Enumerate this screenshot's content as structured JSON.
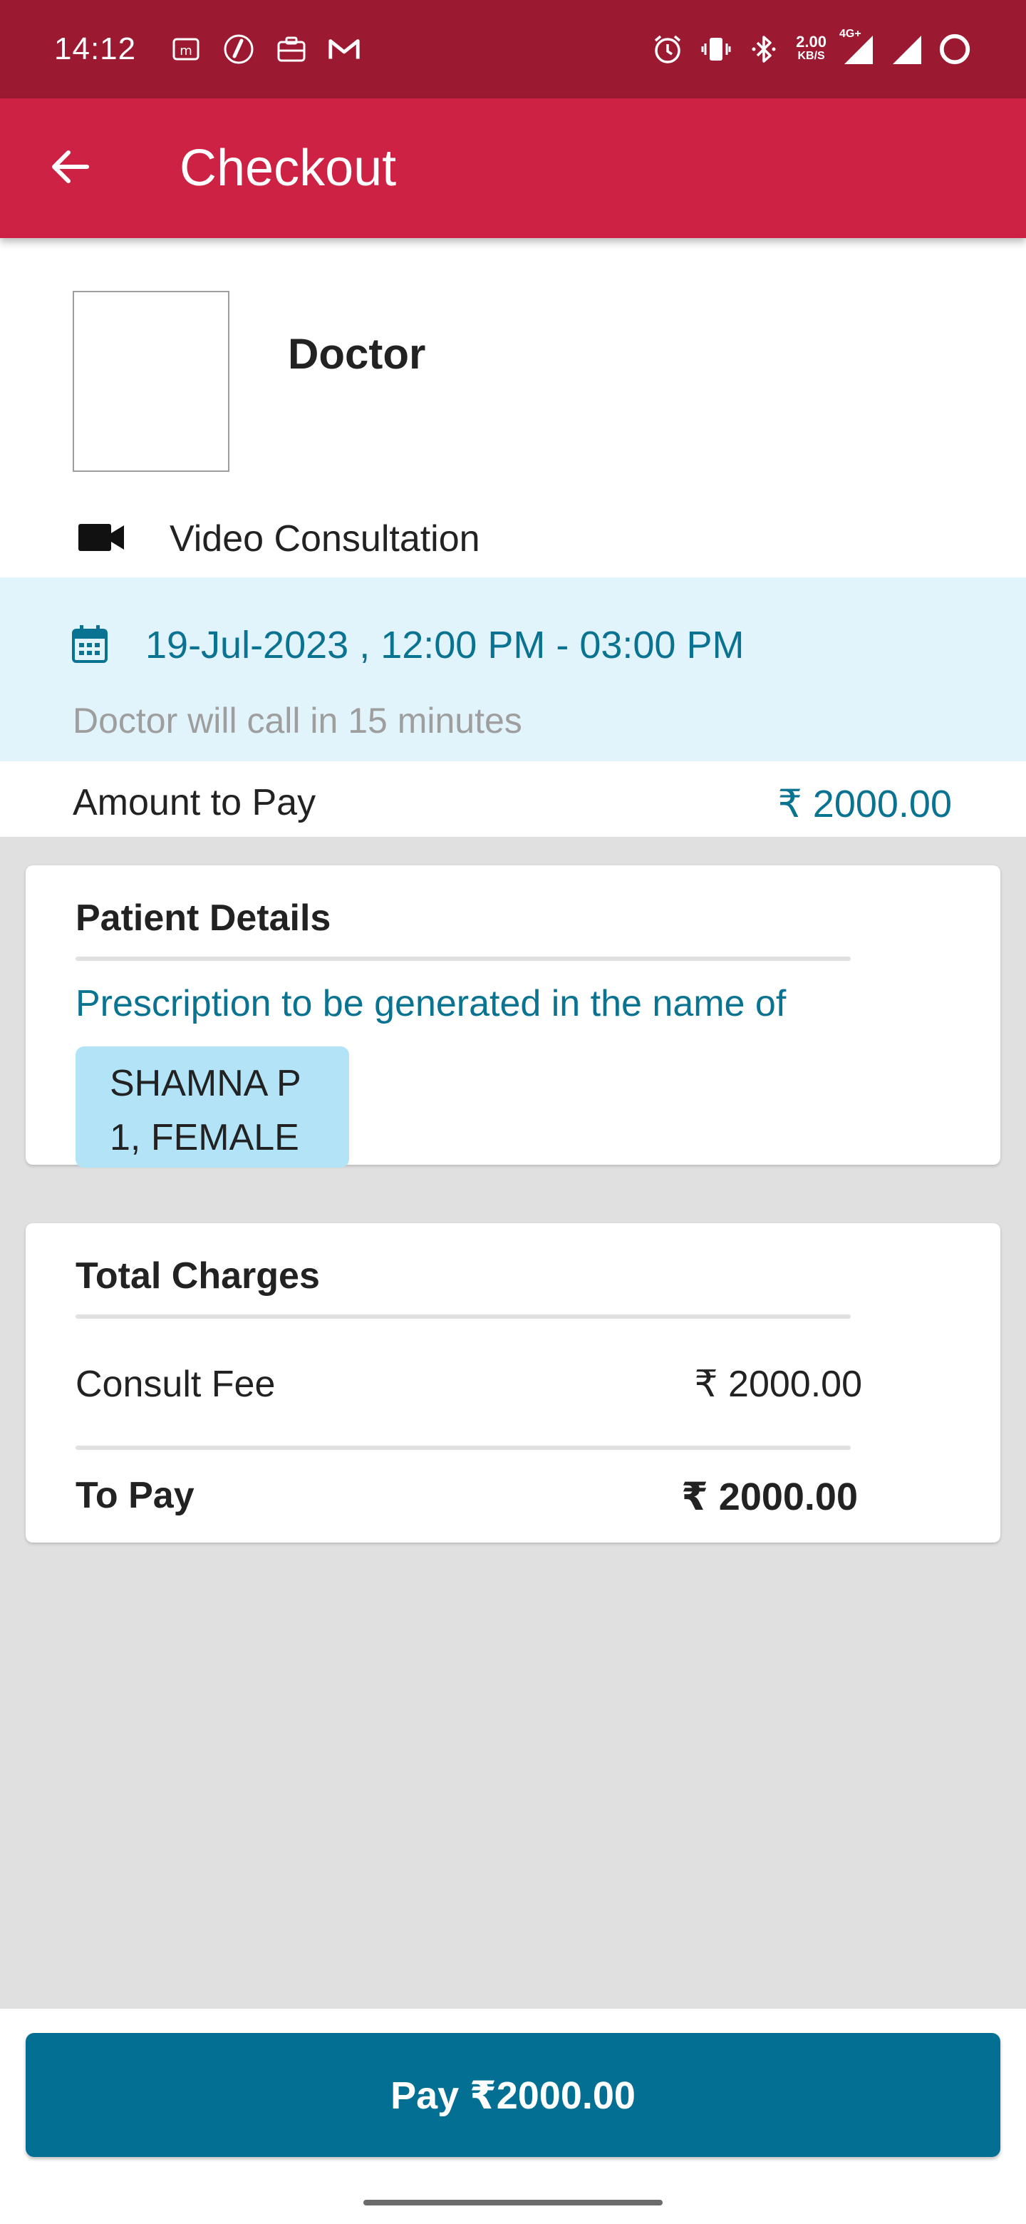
{
  "status_bar": {
    "time": "14:12",
    "left_icons": [
      "messages-icon",
      "app-icon",
      "briefcase-icon",
      "gmail-icon"
    ],
    "right_icons": [
      "alarm-icon",
      "vibrate-icon",
      "bluetooth-icon",
      "network-speed",
      "signal-4g-icon",
      "signal-icon",
      "battery-ring-icon"
    ],
    "speed_value": "2.00",
    "speed_unit": "KB/S",
    "network_type": "4G+"
  },
  "app_bar": {
    "title": "Checkout",
    "back_icon": "arrow-left-icon",
    "color": "#cd2243"
  },
  "doctor": {
    "name": "Doctor",
    "consultation_type": "Video Consultation",
    "consultation_icon": "video-camera-icon"
  },
  "slot": {
    "icon": "calendar-icon",
    "datetime": "19-Jul-2023 , 12:00 PM - 03:00 PM",
    "note": "Doctor will call in 15 minutes"
  },
  "amount": {
    "label": "Amount to Pay",
    "value": "₹ 2000.00"
  },
  "patient_details": {
    "title": "Patient Details",
    "prescription_text": "Prescription to be generated in the name of",
    "patient_name": "SHAMNA P",
    "patient_info": "1, FEMALE"
  },
  "total_charges": {
    "title": "Total Charges",
    "consult_fee_label": "Consult Fee",
    "consult_fee_value": "₹ 2000.00",
    "to_pay_label": "To Pay",
    "to_pay_value": "₹ 2000.00"
  },
  "pay_button": {
    "label": "Pay ₹2000.00",
    "color": "#026f93"
  },
  "colors": {
    "accent_teal": "#0a7391",
    "status_bar": "#9b1a31",
    "slot_background": "#e1f3fb",
    "chip_background": "#b3e3f7"
  }
}
